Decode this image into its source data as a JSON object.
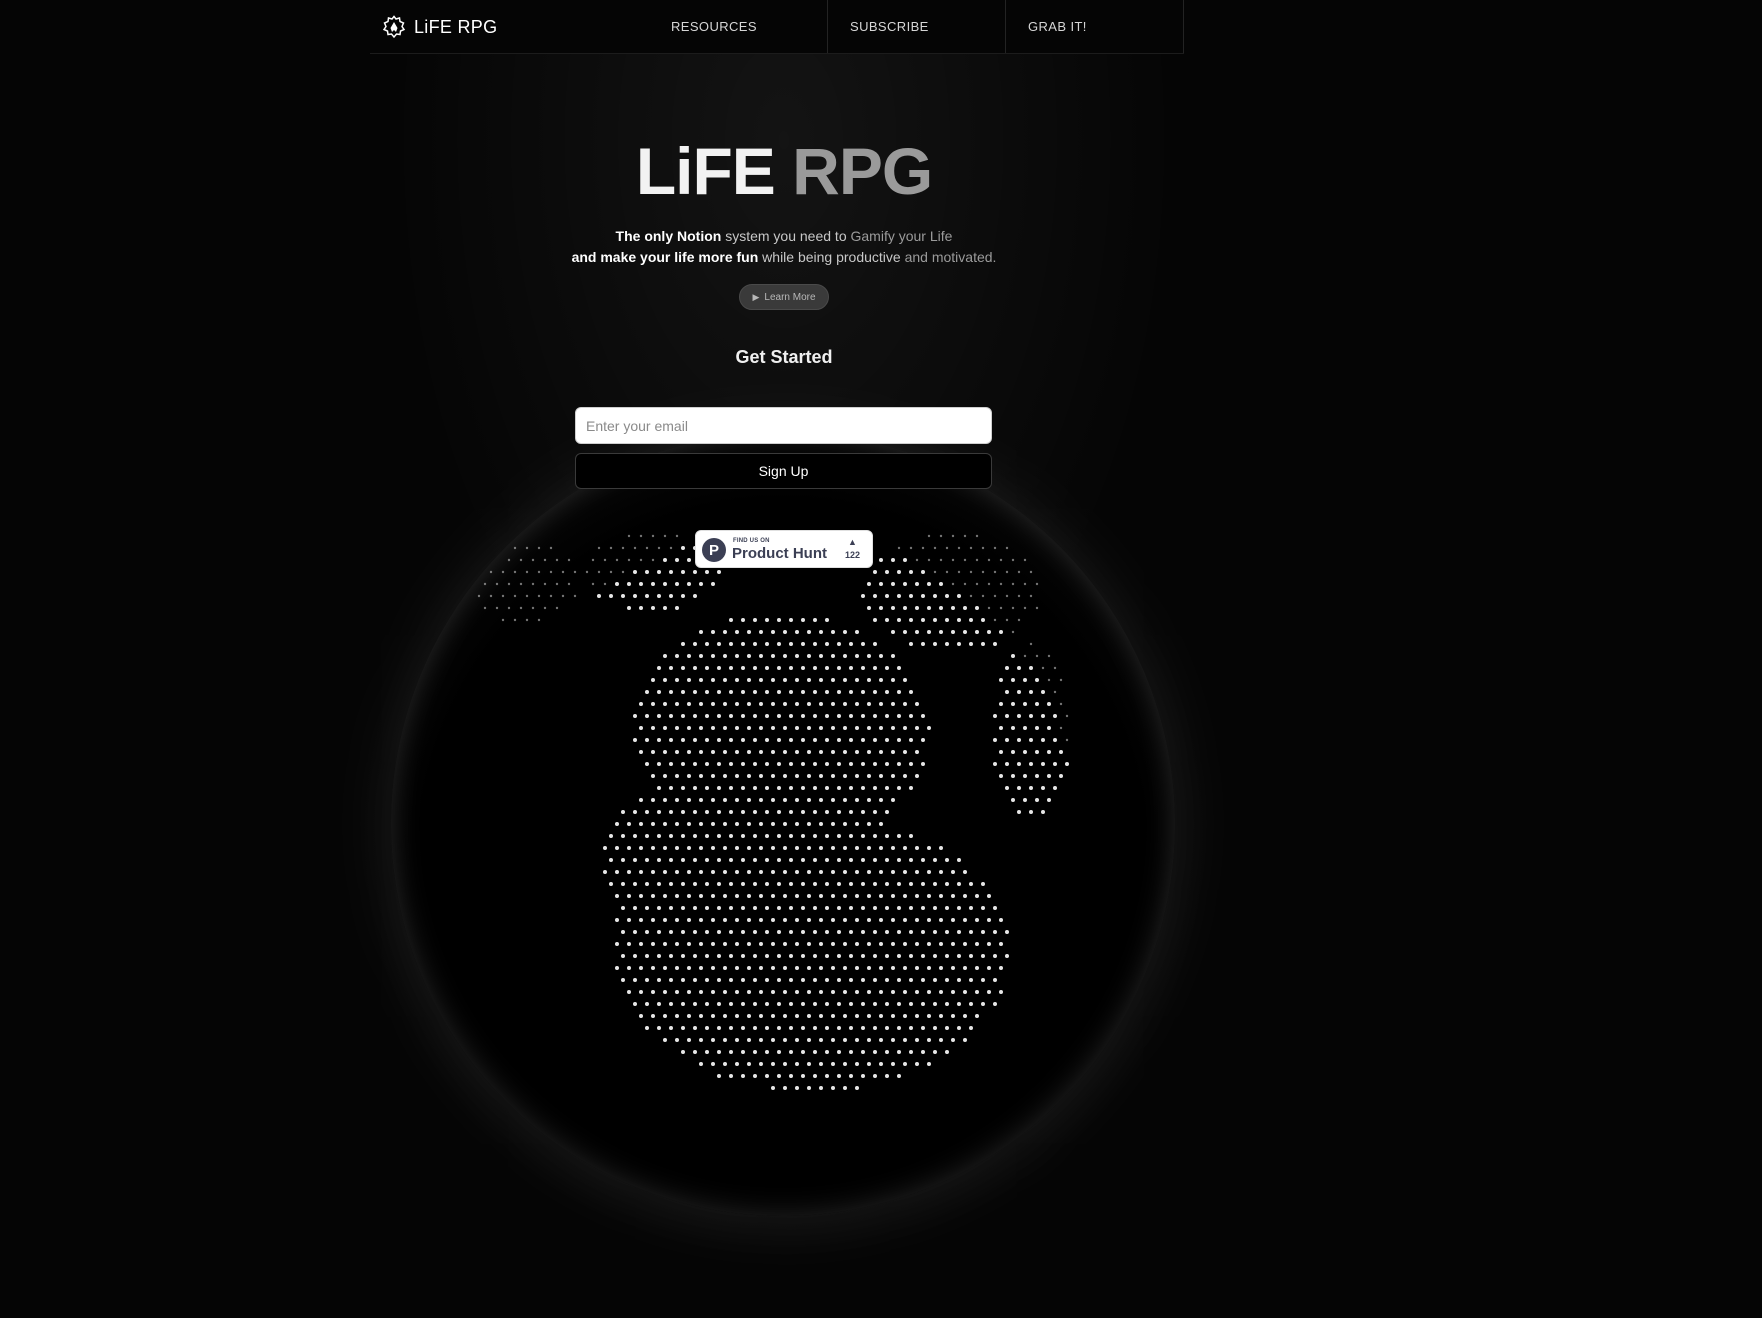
{
  "nav": {
    "brand": "LiFE RPG",
    "brand_icon": "shield-emblem-icon",
    "links": [
      "RESOURCES",
      "SUBSCRIBE",
      "GRAB IT!"
    ]
  },
  "hero": {
    "title_part1": "LiFE",
    "title_part2": "RPG",
    "subtitle_line1_strong": "The only Notion",
    "subtitle_line1_mid": "system you need to",
    "subtitle_line1_dim": "Gamify your Life",
    "subtitle_line2_strong": "and make your life more fun",
    "subtitle_line2_mid": "while being productive",
    "subtitle_line2_dim": "and motivated.",
    "learn_more": "Learn More",
    "play_icon": "play-icon"
  },
  "signup": {
    "heading": "Get Started",
    "email_placeholder": "Enter your email",
    "button_label": "Sign Up"
  },
  "product_hunt": {
    "small_text": "FIND US ON",
    "big_text": "Product Hunt",
    "logo_letter": "P",
    "upvote_icon": "upvote-arrow-icon",
    "count": "122"
  },
  "colors": {
    "background": "#050505",
    "title_light": "#f2f2f2",
    "title_dim": "#9a9a9a",
    "ph_brand": "#3b3f54"
  }
}
